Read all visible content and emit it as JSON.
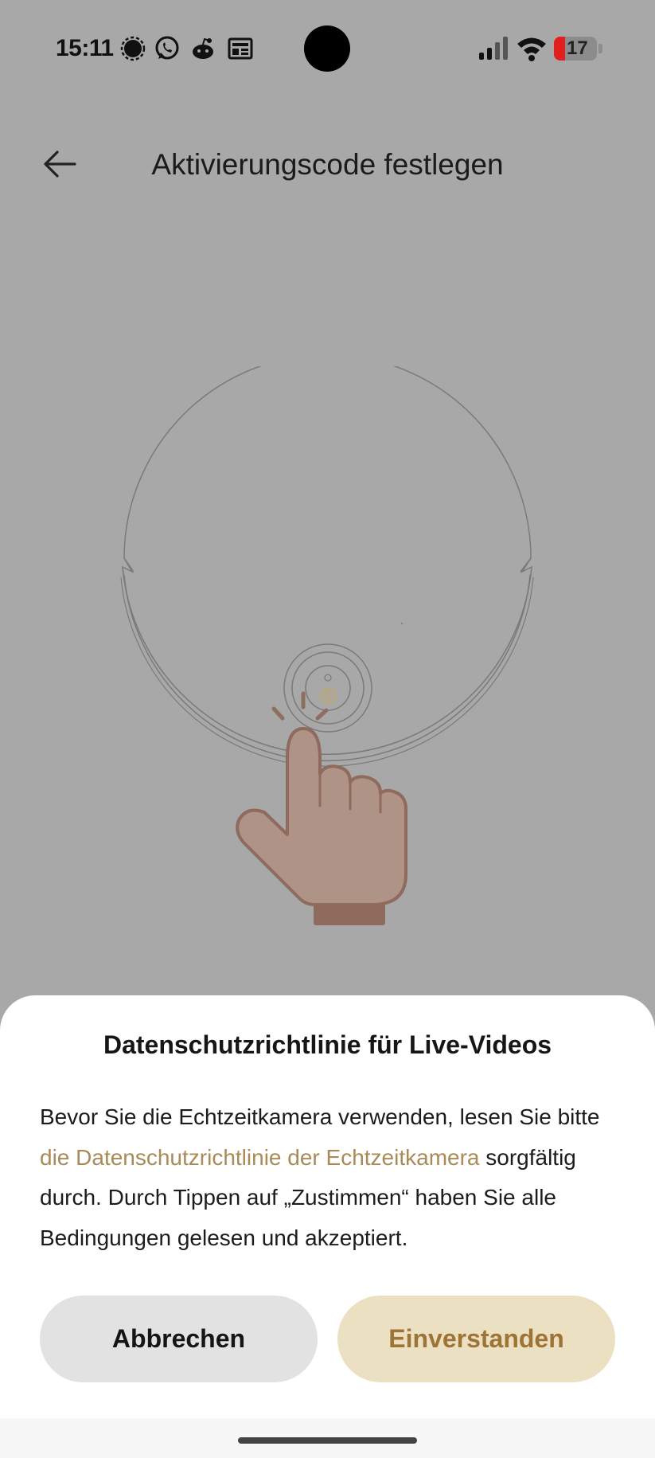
{
  "status_bar": {
    "time": "15:11",
    "notification_icons": [
      "signal-messenger-icon",
      "whatsapp-icon",
      "reddit-icon",
      "news-icon"
    ],
    "battery_level": "17",
    "battery_color": "#e0201f"
  },
  "header": {
    "title": "Aktivierungscode festlegen",
    "back_icon": "arrow-left-icon"
  },
  "illustration": {
    "description_icon": "robot-vacuum-press-button-icon"
  },
  "dialog": {
    "title": "Datenschutzrichtlinie für Live-Videos",
    "body_before": "Bevor Sie die Echtzeitkamera verwenden, lesen Sie bitte ",
    "link_text": "die Datenschutzrichtlinie der Echtzeitkamera",
    "body_after": " sorgfältig durch. Durch Tippen auf „Zustimmen“ haben Sie alle Bedingungen gelesen und akzeptiert.",
    "cancel_label": "Abbrechen",
    "agree_label": "Einverstanden"
  },
  "colors": {
    "accent_link": "#a88b58",
    "agree_bg": "#ece0c3",
    "agree_text": "#9d7436",
    "cancel_bg": "#e2e2e2",
    "overlay_bg": "#a8a8a8"
  }
}
